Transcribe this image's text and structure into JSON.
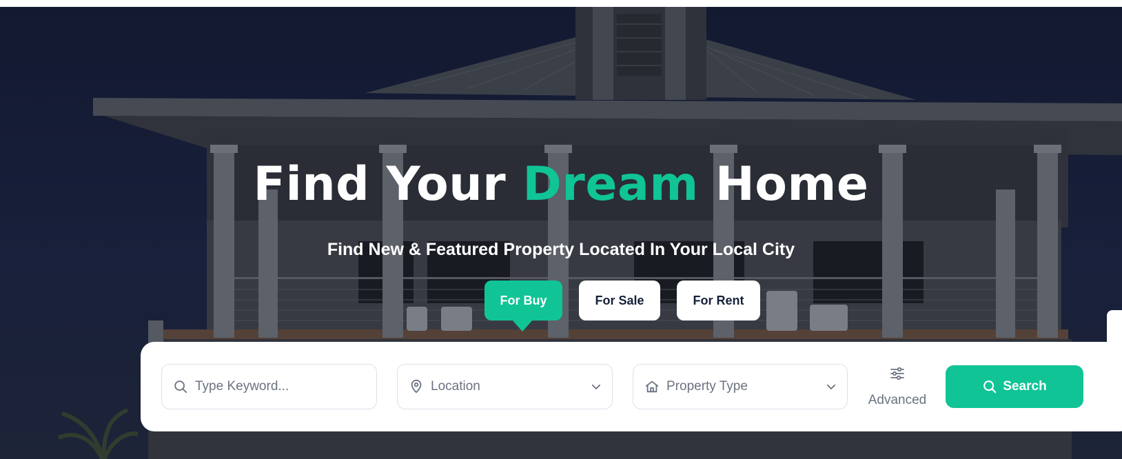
{
  "hero": {
    "title_part1": "Find Your ",
    "title_accent": "Dream",
    "title_part2": " Home",
    "subtitle": "Find New & Featured Property Located In Your Local City"
  },
  "tabs": [
    {
      "label": "For Buy",
      "active": true
    },
    {
      "label": "For Sale",
      "active": false
    },
    {
      "label": "For Rent",
      "active": false
    }
  ],
  "search": {
    "keyword_placeholder": "Type Keyword...",
    "location_label": "Location",
    "property_type_label": "Property Type",
    "advanced_label": "Advanced",
    "search_label": "Search"
  },
  "icons": {
    "keyword": "search-icon",
    "location": "map-pin-icon",
    "property_type": "home-icon",
    "dropdown": "chevron-down-icon",
    "advanced": "sliders-icon",
    "search_button": "search-icon"
  },
  "colors": {
    "accent": "#10c496",
    "dark_text": "#14213a",
    "muted_text": "#6b7280",
    "hero_sky": "#141b36"
  }
}
